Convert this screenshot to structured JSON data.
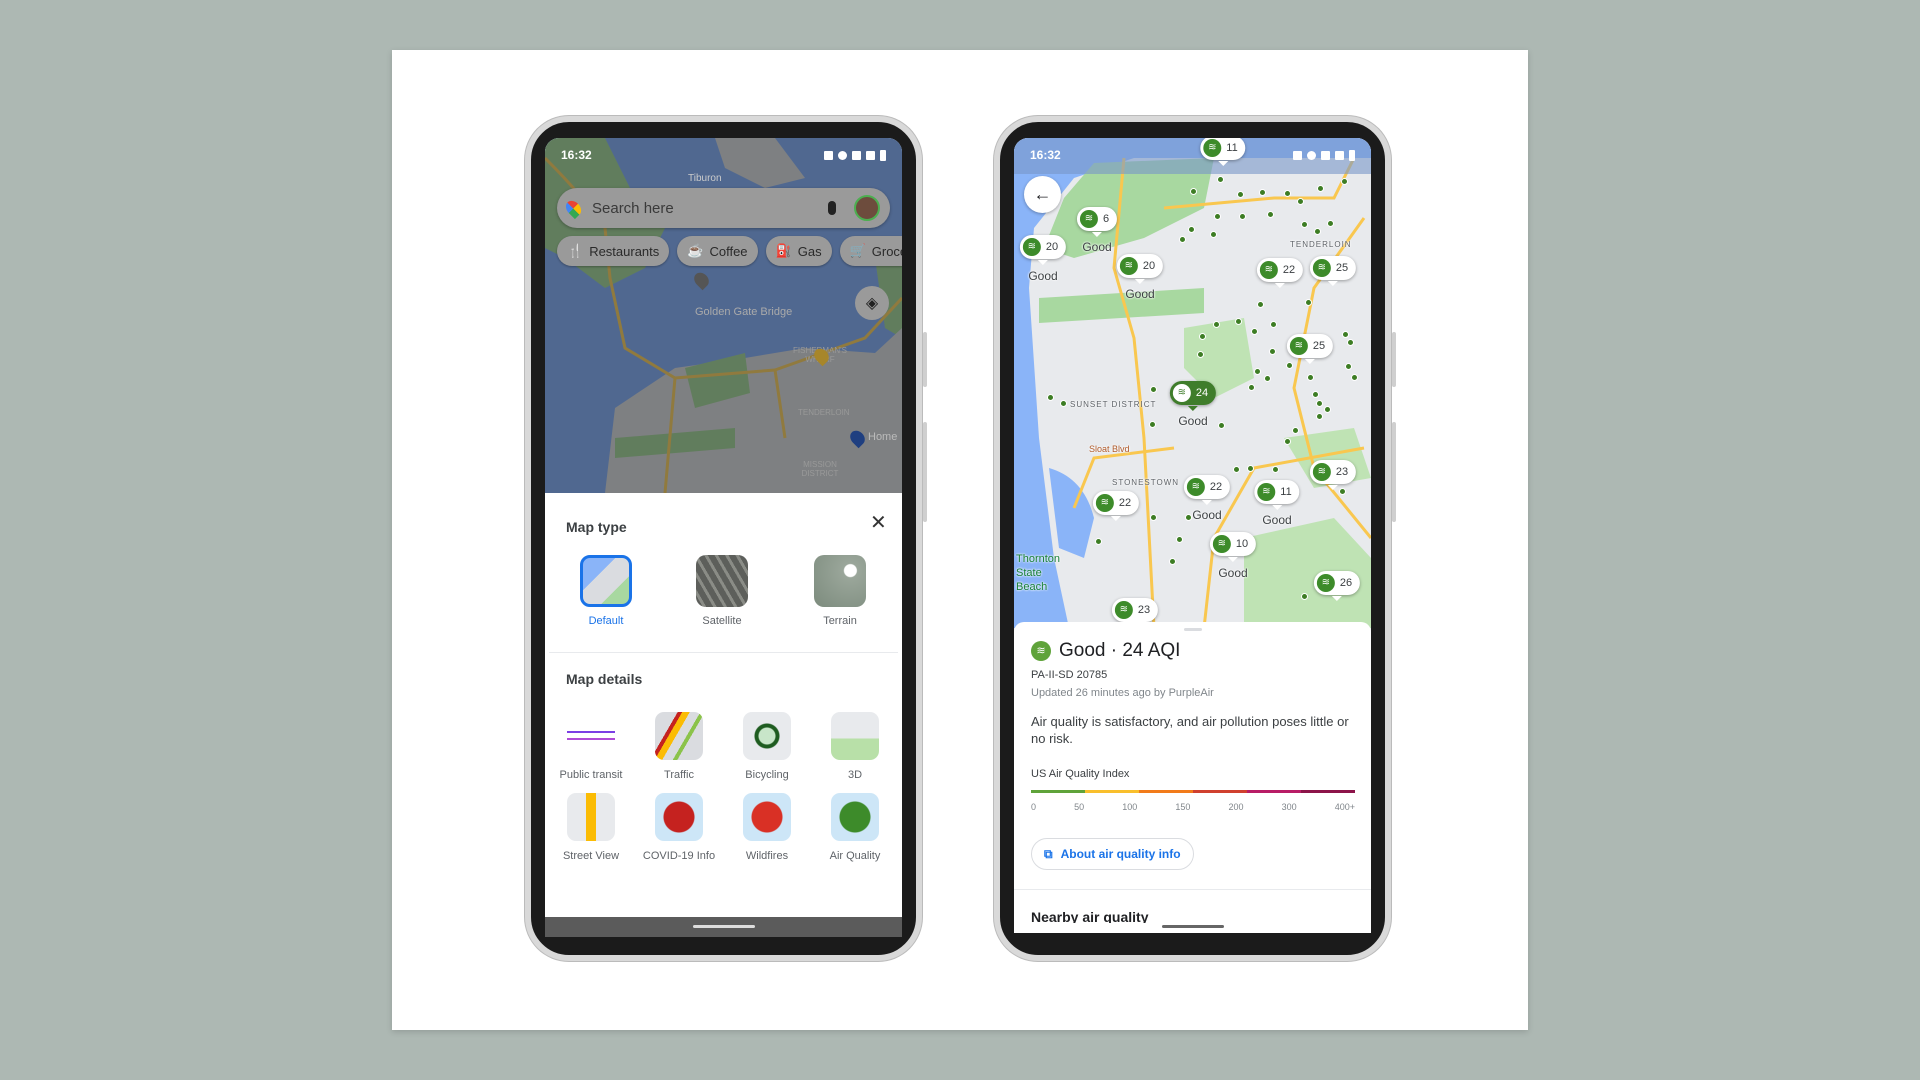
{
  "left_phone": {
    "status": {
      "time": "16:32"
    },
    "map_labels": [
      "Tiburon",
      "Golden Gate Bridge",
      "FISHERMAN'S WHARF",
      "TENDERLOIN",
      "Home",
      "MISSION DISTRICT"
    ],
    "search": {
      "placeholder": "Search here",
      "icon": "google-maps-pin-icon",
      "mic_icon": "microphone-icon"
    },
    "chips": [
      {
        "label": "Restaurants",
        "icon": "fork-knife-icon"
      },
      {
        "label": "Coffee",
        "icon": "coffee-icon"
      },
      {
        "label": "Gas",
        "icon": "gas-pump-icon"
      },
      {
        "label": "Groceries",
        "icon": "cart-icon"
      }
    ],
    "sheet": {
      "map_type_title": "Map type",
      "map_types": [
        {
          "label": "Default",
          "selected": true
        },
        {
          "label": "Satellite",
          "selected": false
        },
        {
          "label": "Terrain",
          "selected": false
        }
      ],
      "map_details_title": "Map details",
      "map_details": [
        {
          "label": "Public transit"
        },
        {
          "label": "Traffic"
        },
        {
          "label": "Bicycling"
        },
        {
          "label": "3D"
        },
        {
          "label": "Street View"
        },
        {
          "label": "COVID-19 Info"
        },
        {
          "label": "Wildfires"
        },
        {
          "label": "Air Quality"
        }
      ]
    },
    "accent": "#1a73e8"
  },
  "right_phone": {
    "status": {
      "time": "16:32"
    },
    "map_labels": [
      "TENDERLOIN",
      "SUNSET DISTRICT",
      "Sloat Blvd",
      "STONESTOWN",
      "Thornton State Beach"
    ],
    "markers": [
      {
        "value": "11"
      },
      {
        "value": "6",
        "status": "Good"
      },
      {
        "value": "20",
        "status": "Good"
      },
      {
        "value": "20",
        "status": "Good"
      },
      {
        "value": "22"
      },
      {
        "value": "25"
      },
      {
        "value": "25"
      },
      {
        "value": "24",
        "status": "Good",
        "selected": true
      },
      {
        "value": "23"
      },
      {
        "value": "22",
        "status": "Good"
      },
      {
        "value": "11",
        "status": "Good"
      },
      {
        "value": "22"
      },
      {
        "value": "10",
        "status": "Good"
      },
      {
        "value": "26"
      },
      {
        "value": "23"
      }
    ],
    "sheet": {
      "headline": "Good · 24 AQI",
      "station": "PA-II-SD 20785",
      "updated": "Updated 26 minutes ago by PurpleAir",
      "description": "Air quality is satisfactory, and air pollution poses little or no risk.",
      "index_title": "US Air Quality Index",
      "scale_ticks": [
        "0",
        "50",
        "100",
        "150",
        "200",
        "300",
        "400+"
      ],
      "scale_colors": [
        "#5fa33a",
        "#f9bf2c",
        "#f27b1a",
        "#d0402f",
        "#b81c66",
        "#8c1449"
      ],
      "about_link": "About air quality info",
      "nearby_title": "Nearby air quality"
    },
    "good_color": "#3d8b2a"
  }
}
